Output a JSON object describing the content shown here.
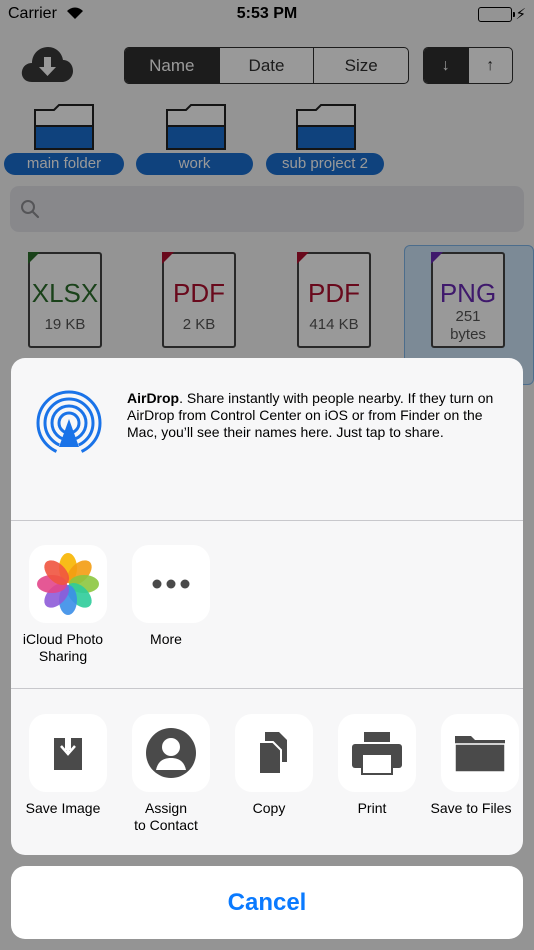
{
  "status": {
    "carrier": "Carrier",
    "time": "5:53 PM"
  },
  "sort_tabs": [
    {
      "label": "Name",
      "active": true
    },
    {
      "label": "Date",
      "active": false
    },
    {
      "label": "Size",
      "active": false
    }
  ],
  "order_buttons": [
    {
      "label": "↓",
      "active": true
    },
    {
      "label": "↑",
      "active": false
    }
  ],
  "folders": [
    {
      "name": "main folder"
    },
    {
      "name": "work"
    },
    {
      "name": "sub project 2"
    }
  ],
  "files": [
    {
      "ext": "XLSX",
      "size": "19 KB",
      "color": "#2c6e2c"
    },
    {
      "ext": "PDF",
      "size": "2 KB",
      "color": "#b01030"
    },
    {
      "ext": "PDF",
      "size": "414 KB",
      "color": "#b01030"
    },
    {
      "ext": "PNG",
      "size_line1": "251",
      "size_line2": "bytes",
      "color": "#6a2bb5"
    }
  ],
  "share_sheet": {
    "airdrop_title": "AirDrop",
    "airdrop_text": ". Share instantly with people nearby. If they turn on AirDrop from Control Center on iOS or from Finder on the Mac, you’ll see their names here. Just tap to share.",
    "apps": [
      {
        "label_line1": "iCloud Photo",
        "label_line2": "Sharing"
      },
      {
        "label_line1": "More",
        "label_line2": ""
      }
    ],
    "actions": [
      {
        "label_line1": "Save Image",
        "label_line2": ""
      },
      {
        "label_line1": "Assign",
        "label_line2": "to Contact"
      },
      {
        "label_line1": "Copy",
        "label_line2": ""
      },
      {
        "label_line1": "Print",
        "label_line2": ""
      },
      {
        "label_line1": "Save to Files",
        "label_line2": ""
      }
    ],
    "cancel_label": "Cancel"
  },
  "colors": {
    "accent": "#0a7aff",
    "folder_label": "#1a6fd1",
    "airdrop": "#1a73e8"
  }
}
